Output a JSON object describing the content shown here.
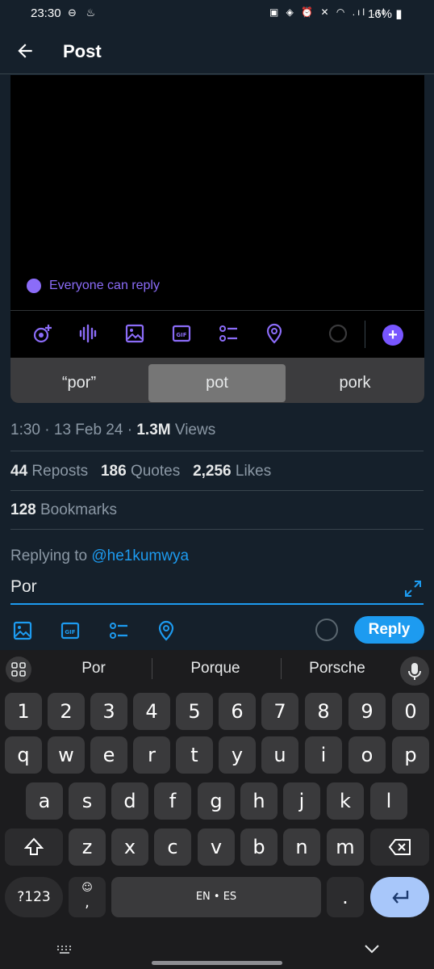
{
  "status": {
    "time": "23:30",
    "battery": "16%"
  },
  "header": {
    "title": "Post"
  },
  "composer": {
    "reply_setting": "Everyone can reply"
  },
  "suggestions_top": [
    "“por”",
    "pot",
    "pork"
  ],
  "post": {
    "time": "1:30",
    "date": "13 Feb 24",
    "views_count": "1.3M",
    "views_label": "Views",
    "reposts_count": "44",
    "reposts_label": "Reposts",
    "quotes_count": "186",
    "quotes_label": "Quotes",
    "likes_count": "2,256",
    "likes_label": "Likes",
    "bookmarks_count": "128",
    "bookmarks_label": "Bookmarks"
  },
  "reply": {
    "replying_to_label": "Replying to",
    "handle": "@he1kumwya",
    "input_value": "Por",
    "button_label": "Reply"
  },
  "keyboard": {
    "suggestions": [
      "Por",
      "Porque",
      "Porsche"
    ],
    "row_numbers": [
      "1",
      "2",
      "3",
      "4",
      "5",
      "6",
      "7",
      "8",
      "9",
      "0"
    ],
    "row_q": [
      "q",
      "w",
      "e",
      "r",
      "t",
      "y",
      "u",
      "i",
      "o",
      "p"
    ],
    "row_a": [
      "a",
      "s",
      "d",
      "f",
      "g",
      "h",
      "j",
      "k",
      "l"
    ],
    "row_z": [
      "z",
      "x",
      "c",
      "v",
      "b",
      "n",
      "m"
    ],
    "symbols_label": "?123",
    "comma_label": ",",
    "space_label": "EN • ES",
    "period_label": "."
  },
  "colors": {
    "accent": "#1d9bf0",
    "composer_accent": "#8b6cf8",
    "background": "#15202b"
  }
}
